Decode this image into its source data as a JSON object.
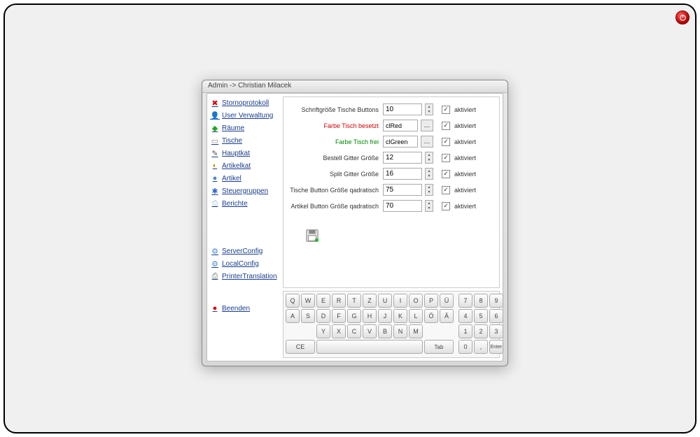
{
  "window_title": "Admin -> Christian Milacek",
  "sidebar": {
    "group1": [
      {
        "icon": "✖",
        "iconColor": "#d00",
        "label": "Stornoprotokoll",
        "name": "nav-stornoprotokoll"
      },
      {
        "icon": "👤",
        "iconColor": "#c77",
        "label": "User Verwaltung",
        "name": "nav-user-verwaltung"
      },
      {
        "icon": "◆",
        "iconColor": "#2a2",
        "label": "Räume",
        "name": "nav-raeume"
      },
      {
        "icon": "▭",
        "iconColor": "#888",
        "label": "Tische",
        "name": "nav-tische"
      },
      {
        "icon": "✎",
        "iconColor": "#555",
        "label": "Hauptkat",
        "name": "nav-hauptkat"
      },
      {
        "icon": "◐",
        "iconColor": "#c90",
        "label": "Artikelkat",
        "name": "nav-artikelkat"
      },
      {
        "icon": "●",
        "iconColor": "#48c",
        "label": "Artikel",
        "name": "nav-artikel"
      },
      {
        "icon": "✱",
        "iconColor": "#36c",
        "label": "Steuergruppen",
        "name": "nav-steuergruppen"
      },
      {
        "icon": "⎙",
        "iconColor": "#9bd",
        "label": "Berichte",
        "name": "nav-berichte"
      }
    ],
    "group2": [
      {
        "icon": "⚙",
        "iconColor": "#48c",
        "label": "ServerConfig",
        "name": "nav-serverconfig"
      },
      {
        "icon": "⚙",
        "iconColor": "#48c",
        "label": "LocalConfig",
        "name": "nav-localconfig"
      },
      {
        "icon": "⎙",
        "iconColor": "#666",
        "label": "PrinterTranslation",
        "name": "nav-printertranslation"
      }
    ],
    "group3": [
      {
        "icon": "●",
        "iconColor": "#d00",
        "label": "Beenden",
        "name": "nav-beenden"
      }
    ]
  },
  "form": {
    "rows": [
      {
        "label": "Schriftgröße Tische Buttons",
        "value": "10",
        "type": "spin",
        "cb": "aktiviert"
      },
      {
        "label": "Farbe Tisch besetzt",
        "value": "clRed",
        "type": "color",
        "labelClass": "red",
        "cb": "aktiviert"
      },
      {
        "label": "Farbe Tisch frei",
        "value": "clGreen",
        "type": "color",
        "labelClass": "green",
        "cb": "aktiviert"
      },
      {
        "label": "Bestell Gitter Größe",
        "value": "12",
        "type": "spin",
        "cb": "aktiviert"
      },
      {
        "label": "Split Gitter Größe",
        "value": "16",
        "type": "spin",
        "cb": "aktiviert"
      },
      {
        "label": "Tische Button Größe qadratisch",
        "value": "75",
        "type": "spin",
        "cb": "aktiviert"
      },
      {
        "label": "Artikel Button Größe qadratisch",
        "value": "70",
        "type": "spin",
        "cb": "aktiviert"
      }
    ]
  },
  "keyboard": {
    "row1": [
      "Q",
      "W",
      "E",
      "R",
      "T",
      "Z",
      "U",
      "I",
      "O",
      "P",
      "Ü"
    ],
    "row2": [
      "A",
      "S",
      "D",
      "F",
      "G",
      "H",
      "J",
      "K",
      "L",
      "Ö",
      "Ä"
    ],
    "row3": [
      "Y",
      "X",
      "C",
      "V",
      "B",
      "N",
      "M"
    ],
    "ce": "CE",
    "tab": "Tab",
    "numpad": [
      [
        "7",
        "8",
        "9"
      ],
      [
        "4",
        "5",
        "6"
      ],
      [
        "1",
        "2",
        "3"
      ],
      [
        "0",
        ",",
        "Enter"
      ]
    ],
    "enter": "Enter"
  }
}
